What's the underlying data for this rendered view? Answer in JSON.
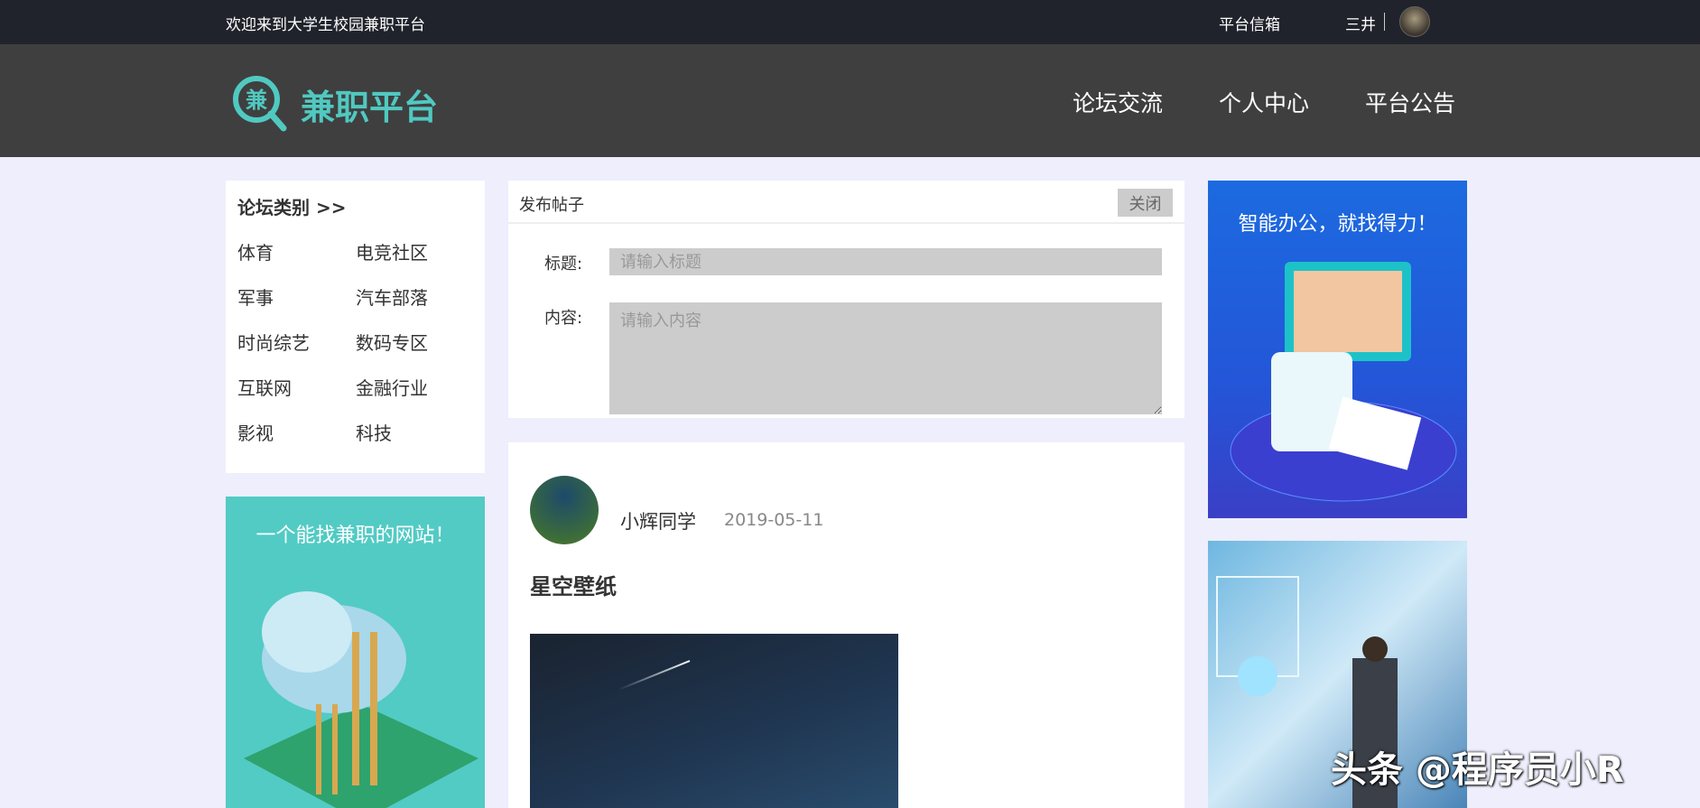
{
  "topbar": {
    "welcome": "欢迎来到大学生校园兼职平台",
    "mailbox": "平台信箱",
    "username": "三井"
  },
  "nav": {
    "logo_text": "兼职平台",
    "logo_glyph": "兼",
    "items": [
      "论坛交流",
      "个人中心",
      "平台公告"
    ]
  },
  "categories": {
    "title": "论坛类别 >>",
    "items": [
      "体育",
      "电竞社区",
      "军事",
      "汽车部落",
      "时尚综艺",
      "数码专区",
      "互联网",
      "金融行业",
      "影视",
      "科技"
    ]
  },
  "left_ad": {
    "text": "一个能找兼职的网站！"
  },
  "publish": {
    "title": "发布帖子",
    "close_label": "关闭",
    "title_label": "标题:",
    "title_placeholder": "请输入标题",
    "content_label": "内容:",
    "content_placeholder": "请输入内容"
  },
  "post": {
    "author": "小辉同学",
    "date": "2019-05-11",
    "title": "星空壁纸"
  },
  "right_ads": [
    {
      "text": "智能办公，就找得力！"
    },
    {
      "text": ""
    }
  ],
  "watermark": "头条 @程序员小R",
  "colors": {
    "brand": "#50c9c1",
    "topbar": "#20232b",
    "nav": "#3f3f3f",
    "background": "#eeeefc"
  }
}
